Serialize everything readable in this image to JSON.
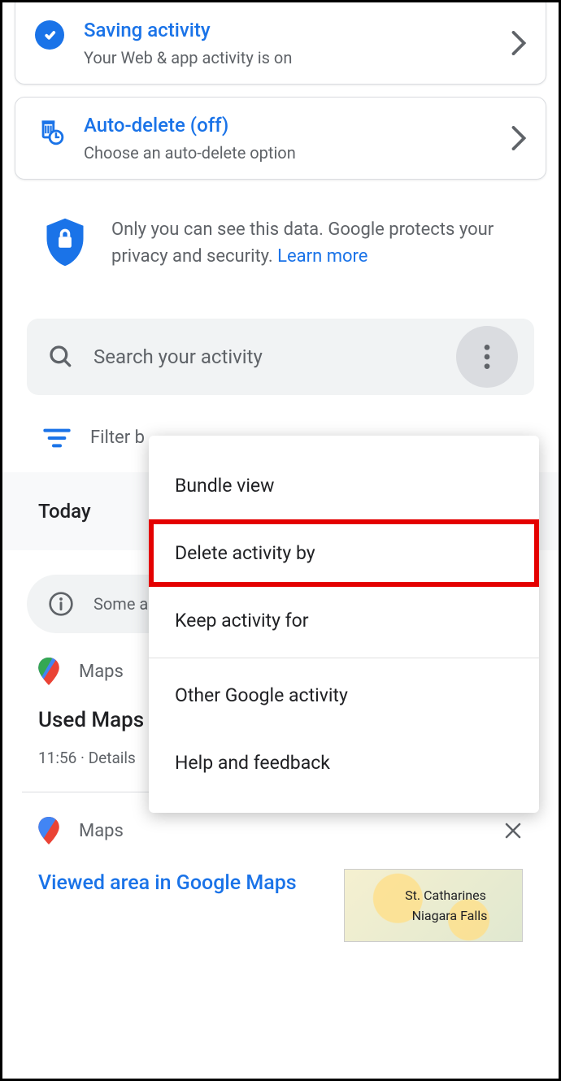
{
  "cards": {
    "saving": {
      "title": "Saving activity",
      "sub": "Your Web & app activity is on"
    },
    "autodelete": {
      "title": "Auto-delete (off)",
      "sub": "Choose an auto-delete option"
    }
  },
  "privacy": {
    "text": "Only you can see this data. Google protects your privacy and security. ",
    "link": "Learn more"
  },
  "search": {
    "placeholder": "Search your activity"
  },
  "filter": {
    "label": "Filter b"
  },
  "section": {
    "today": "Today"
  },
  "info_banner": "Some a",
  "activity": {
    "maps1": {
      "app": "Maps",
      "title": "Used Maps",
      "time": "11:56 · Details"
    },
    "maps2": {
      "app": "Maps",
      "title": "Viewed area in Google Maps",
      "thumb": {
        "l1": "St. Catharines",
        "l2": "Niagara Falls"
      }
    }
  },
  "menu": {
    "items": {
      "bundle": "Bundle view",
      "delete": "Delete activity by",
      "keep": "Keep activity for",
      "other": "Other Google activity",
      "help": "Help and feedback"
    }
  }
}
